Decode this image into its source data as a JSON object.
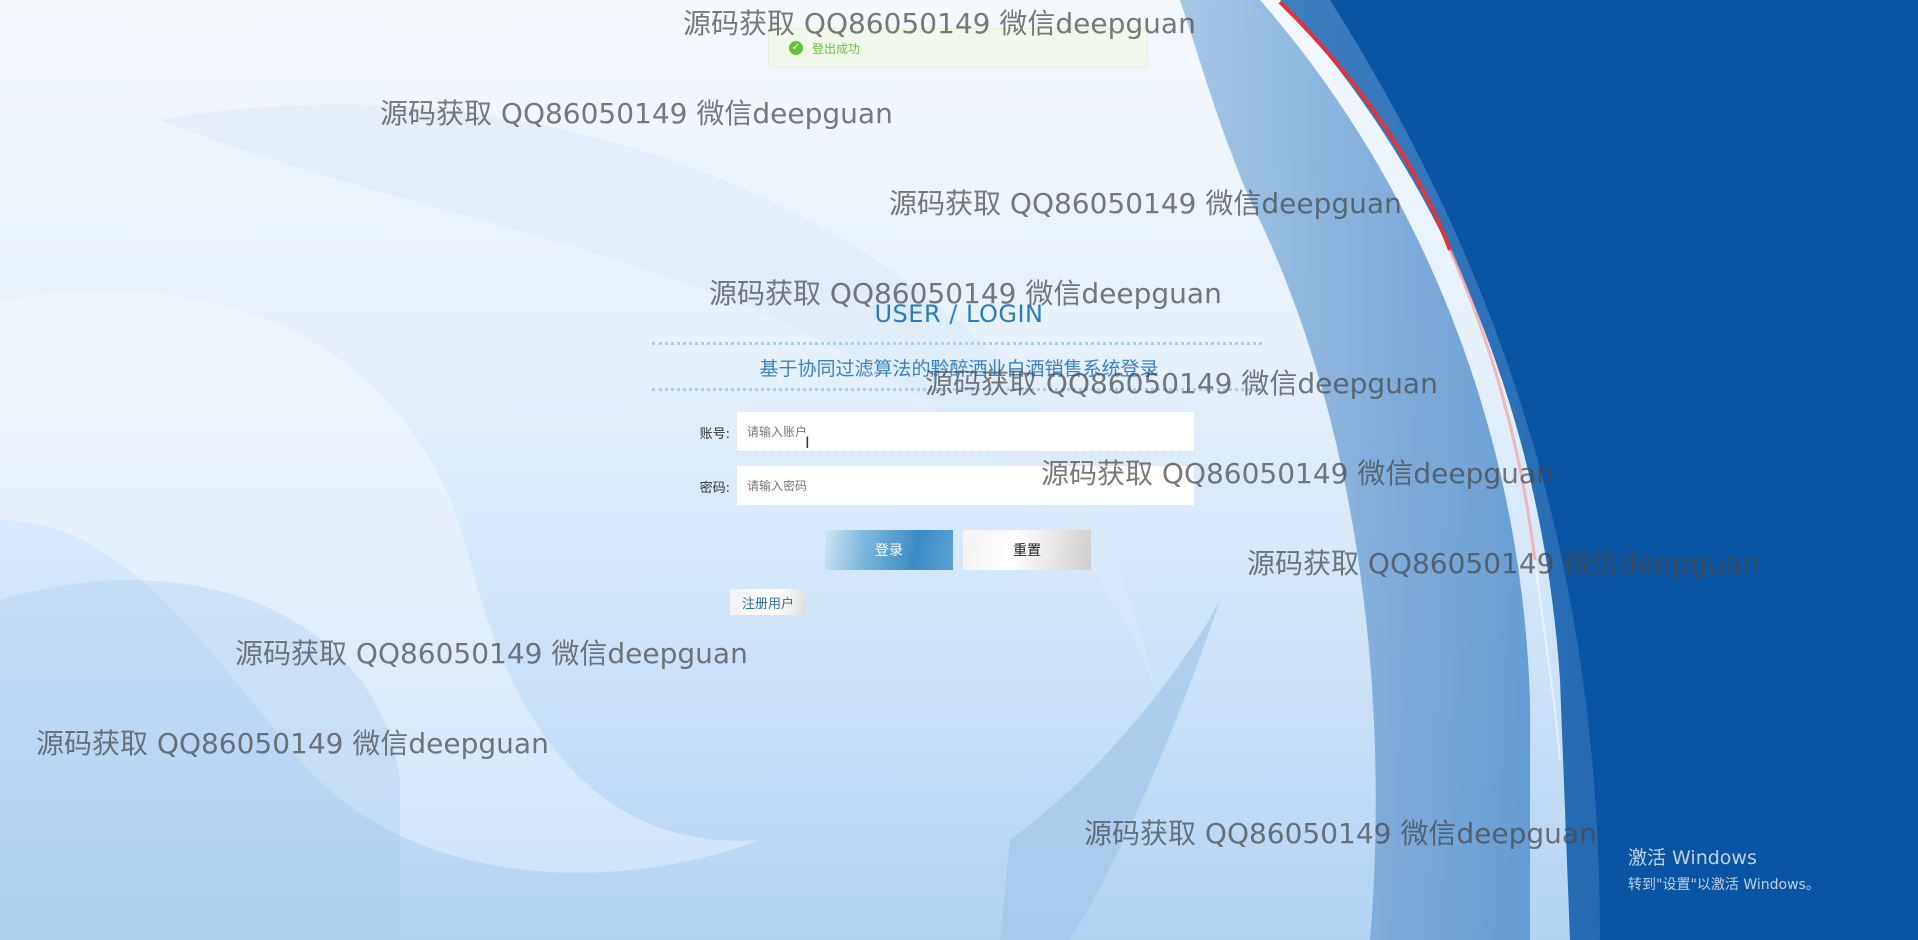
{
  "toast": {
    "icon": "check-icon",
    "message": "登出成功",
    "color": "#67c23a"
  },
  "login": {
    "title": "USER / LOGIN",
    "subtitle": "基于协同过滤算法的黔醉酒业白酒销售系统登录",
    "account_label": "账号:",
    "account_placeholder": "请输入账户",
    "account_value": "",
    "password_label": "密码:",
    "password_placeholder": "请输入密码",
    "password_value": "",
    "login_button": "登录",
    "reset_button": "重置",
    "register_link": "注册用户"
  },
  "watermarks": [
    "源码获取 QQ86050149 微信deepguan",
    "源码获取 QQ86050149 微信deepguan",
    "源码获取 QQ86050149 微信deepguan",
    "源码获取 QQ86050149 微信deepguan",
    "源码获取 QQ86050149 微信deepguan",
    "源码获取 QQ86050149 微信deepguan",
    "源码获取 QQ86050149 微信deepguan",
    "源码获取 QQ86050149 微信deepguan",
    "源码获取 QQ86050149 微信deepguan",
    "源码获取 QQ86050149 微信deepguan"
  ],
  "windows_activation": {
    "title": "激活 Windows",
    "subtitle": "转到\"设置\"以激活 Windows。"
  },
  "colors": {
    "accent": "#2b7bbf",
    "background_blue": "#0a55a3",
    "edge_red": "#e0333b"
  }
}
